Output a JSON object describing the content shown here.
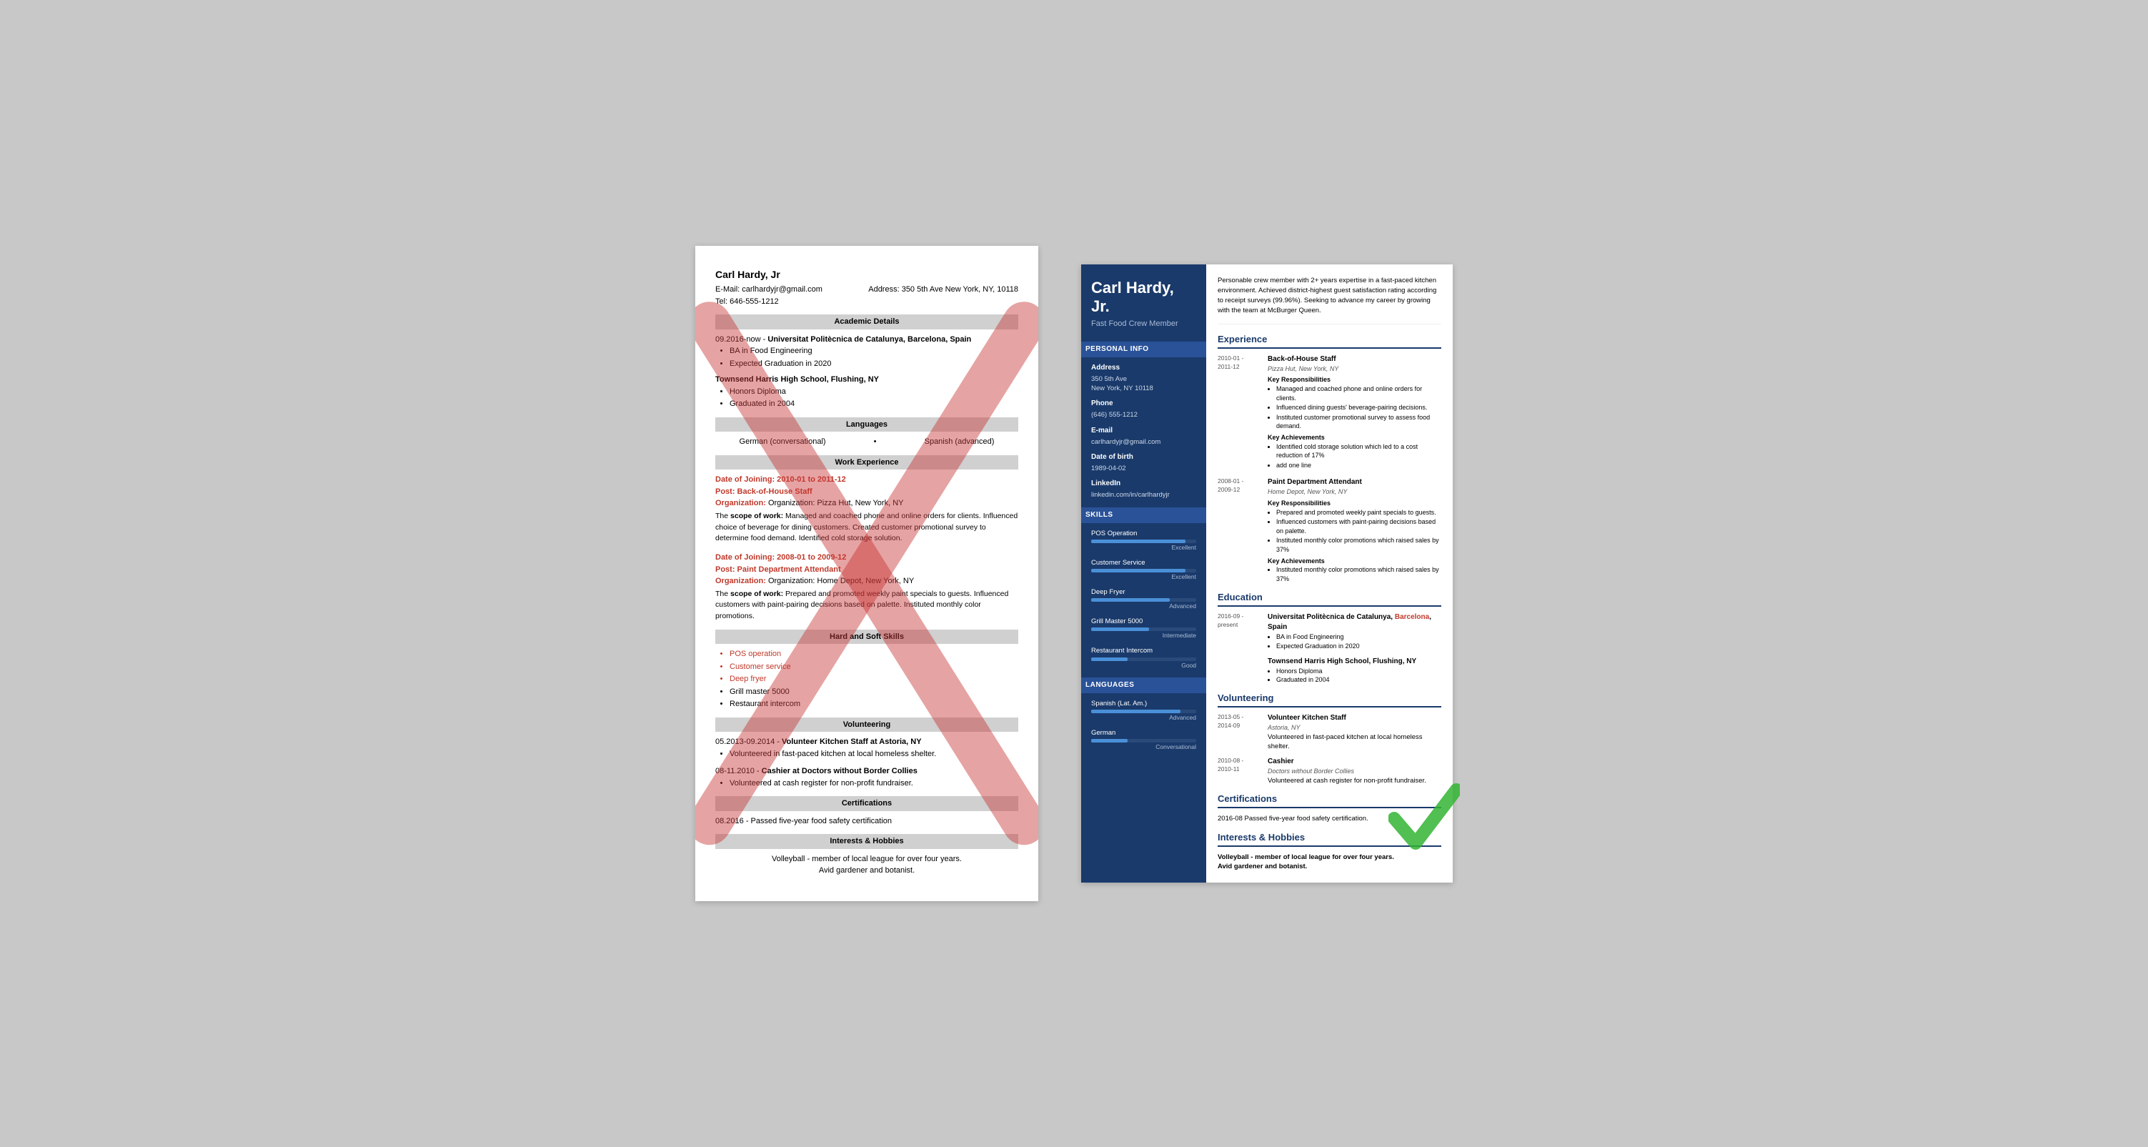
{
  "left_resume": {
    "name": "Carl Hardy, Jr",
    "email": "E-Mail: carlhardyjr@gmail.com",
    "phone": "Tel: 646-555-1212",
    "address": "Address: 350 5th Ave New York, NY, 10118",
    "sections": {
      "academic": {
        "header": "Academic Details",
        "entry1_date": "09.2016-now -",
        "entry1_school": "Universitat Politècnica de Catalunya, Barcelona, Spain",
        "entry1_items": [
          "BA in Food Engineering",
          "Expected Graduation in 2020"
        ],
        "entry2_school": "Townsend Harris High School, Flushing, NY",
        "entry2_items": [
          "Honors Diploma",
          "Graduated in 2004"
        ]
      },
      "languages": {
        "header": "Languages",
        "items": [
          "German (conversational)",
          "Spanish (advanced)"
        ]
      },
      "work": {
        "header": "Work Experience",
        "entries": [
          {
            "date": "Date of Joining: 2010-01 to 2011-12",
            "post": "Post: Back-of-House Staff",
            "org": "Organization: Pizza Hut, New York, NY",
            "scope": "The scope of work: Managed and coached phone and online orders for clients. Influenced choice of beverage for dining customers. Created customer promotional survey to determine food demand. Identified cold storage solution."
          },
          {
            "date": "Date of Joining: 2008-01 to 2009-12",
            "post": "Post: Paint Department Attendant",
            "org": "Organization: Home Depot, New York, NY",
            "scope": "The scope of work: Prepared and promoted weekly paint specials to guests. Influenced customers with paint-pairing decisions based on palette. Instituted monthly color promotions."
          }
        ]
      },
      "skills": {
        "header": "Hard and Soft Skills",
        "items": [
          "POS operation",
          "Customer service",
          "Deep fryer",
          "Grill master 5000",
          "Restaurant intercom"
        ]
      },
      "volunteering": {
        "header": "Volunteering",
        "entries": [
          {
            "date": "05.2013-09.2014 -",
            "title": "Volunteer Kitchen Staff at Astoria, NY",
            "items": [
              "Volunteered in fast-paced kitchen at local homeless shelter."
            ]
          },
          {
            "date": "08-11.2010 -",
            "title": "Cashier at Doctors without Border Collies",
            "items": [
              "Volunteered at cash register for non-profit fundraiser."
            ]
          }
        ]
      },
      "certifications": {
        "header": "Certifications",
        "text": "08.2016 - Passed five-year food safety certification"
      },
      "hobbies": {
        "header": "Interests & Hobbies",
        "text1": "Volleyball - member of local league for over four years.",
        "text2": "Avid gardener and botanist."
      }
    }
  },
  "right_resume": {
    "name": "Carl Hardy, Jr.",
    "job_title": "Fast Food Crew Member",
    "summary": "Personable crew member with 2+ years expertise in a fast-paced kitchen environment. Achieved district-highest guest satisfaction rating according to receipt surveys (99.96%). Seeking to advance my career by growing with the team at McBurger Queen.",
    "personal_info": {
      "label": "Personal Info",
      "address_label": "Address",
      "address": "350 5th Ave\nNew York, NY 10118",
      "phone_label": "Phone",
      "phone": "(646) 555-1212",
      "email_label": "E-mail",
      "email": "carlhardyjr@gmail.com",
      "dob_label": "Date of birth",
      "dob": "1989-04-02",
      "linkedin_label": "LinkedIn",
      "linkedin": "linkedin.com/in/carlhardyjr"
    },
    "skills": {
      "label": "Skills",
      "items": [
        {
          "name": "POS Operation",
          "level": "Excellent",
          "pct": 90
        },
        {
          "name": "Customer Service",
          "level": "Excellent",
          "pct": 90
        },
        {
          "name": "Deep Fryer",
          "level": "Advanced",
          "pct": 75
        },
        {
          "name": "Grill Master 5000",
          "level": "Intermediate",
          "pct": 55
        },
        {
          "name": "Restaurant Intercom",
          "level": "Good",
          "pct": 35
        }
      ]
    },
    "languages": {
      "label": "Languages",
      "items": [
        {
          "name": "Spanish (Lat. Am.)",
          "level": "Advanced",
          "pct": 85
        },
        {
          "name": "German",
          "level": "Conversational",
          "pct": 35
        }
      ]
    },
    "experience": {
      "label": "Experience",
      "entries": [
        {
          "date": "2010-01 -\n2011-12",
          "title": "Back-of-House Staff",
          "company": "Pizza Hut, New York, NY",
          "responsibilities_label": "Key Responsibilities",
          "responsibilities": [
            "Managed and coached phone and online orders for clients.",
            "Influenced dining guests' beverage-pairing decisions.",
            "Instituted customer promotional survey to assess food demand."
          ],
          "achievements_label": "Key Achievements",
          "achievements": [
            "Identified cold storage solution which led to a cost reduction of 17%",
            "add one line"
          ]
        },
        {
          "date": "2008-01 -\n2009-12",
          "title": "Paint Department Attendant",
          "company": "Home Depot, New York, NY",
          "responsibilities_label": "Key Responsibilities",
          "responsibilities": [
            "Prepared and promoted weekly paint specials to guests.",
            "Influenced customers with paint-pairing decisions based on palette.",
            "Instituted monthly color promotions which raised sales by 37%"
          ],
          "achievements_label": "Key Achievements",
          "achievements": [
            "Instituted monthly color promotions which raised sales by 37%"
          ]
        }
      ]
    },
    "education": {
      "label": "Education",
      "entries": [
        {
          "date": "2016-09 -\npresent",
          "school": "Universitat Politècnica de Catalunya, Barcelona, Spain",
          "items": [
            "BA in Food Engineering",
            "Expected Graduation in 2020"
          ]
        },
        {
          "date": "",
          "school": "Townsend Harris High School, Flushing, NY",
          "items": [
            "Honors Diploma",
            "Graduated in 2004"
          ]
        }
      ]
    },
    "volunteering": {
      "label": "Volunteering",
      "entries": [
        {
          "date": "2013-05 -\n2014-09",
          "title": "Volunteer Kitchen Staff",
          "org": "Astoria, NY",
          "desc": "Volunteered in fast-paced kitchen at local homeless shelter."
        },
        {
          "date": "2010-08 -\n2010-11",
          "title": "Cashier",
          "org": "Doctors without Border Collies",
          "desc": "Volunteered at cash register for non-profit fundraiser."
        }
      ]
    },
    "certifications": {
      "label": "Certifications",
      "text": "2016-08    Passed five-year food safety certification."
    },
    "hobbies": {
      "label": "Interests & Hobbies",
      "text1": "Volleyball - member of local league for over four years.",
      "text2": "Avid gardener and botanist."
    }
  }
}
